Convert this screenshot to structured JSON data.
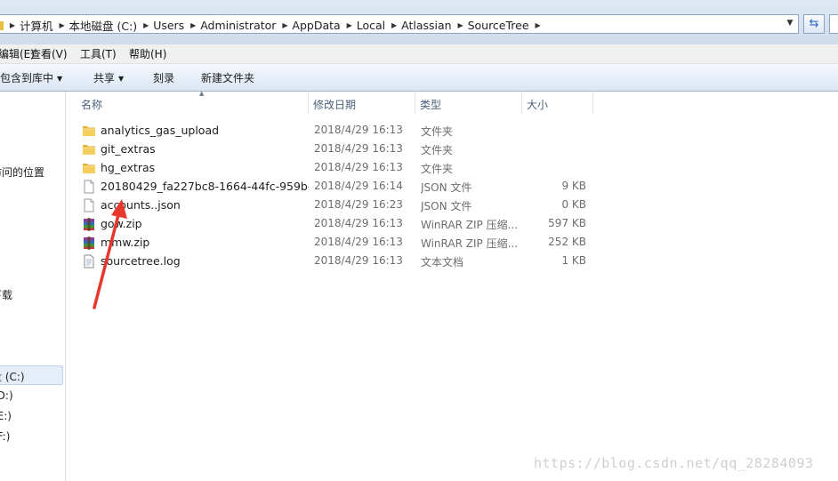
{
  "address_bar": {
    "crumbs": [
      "计算机",
      "本地磁盘 (C:)",
      "Users",
      "Administrator",
      "AppData",
      "Local",
      "Atlassian",
      "SourceTree"
    ]
  },
  "menu": {
    "items": [
      "编辑(E)",
      "查看(V)",
      "工具(T)",
      "帮助(H)"
    ]
  },
  "toolbar": {
    "include_library": "包含到库中",
    "share": "共享",
    "burn": "刻录",
    "new_folder": "新建文件夹"
  },
  "nav": {
    "recent_places": "最近访问的位置",
    "downloads": "下载",
    "drive_c": "本地磁盘 (C:)",
    "drive_d": "(D:)",
    "drive_e": "(E:)",
    "drive_f": "(F:)"
  },
  "columns": {
    "name": "名称",
    "date": "修改日期",
    "type": "类型",
    "size": "大小"
  },
  "files": [
    {
      "name": "analytics_gas_upload",
      "date": "2018/4/29 16:13",
      "type": "文件夹",
      "size": "",
      "icon": "folder-icon"
    },
    {
      "name": "git_extras",
      "date": "2018/4/29 16:13",
      "type": "文件夹",
      "size": "",
      "icon": "folder-icon"
    },
    {
      "name": "hg_extras",
      "date": "2018/4/29 16:13",
      "type": "文件夹",
      "size": "",
      "icon": "folder-icon"
    },
    {
      "name": "20180429_fa227bc8-1664-44fc-959b-...",
      "date": "2018/4/29 16:14",
      "type": "JSON 文件",
      "size": "9 KB",
      "icon": "file-icon"
    },
    {
      "name": "accounts..json",
      "date": "2018/4/29 16:23",
      "type": "JSON 文件",
      "size": "0 KB",
      "icon": "file-icon"
    },
    {
      "name": "gow.zip",
      "date": "2018/4/29 16:13",
      "type": "WinRAR ZIP 压缩...",
      "size": "597 KB",
      "icon": "winrar-archive-icon"
    },
    {
      "name": "mmw.zip",
      "date": "2018/4/29 16:13",
      "type": "WinRAR ZIP 压缩...",
      "size": "252 KB",
      "icon": "winrar-archive-icon"
    },
    {
      "name": "sourcetree.log",
      "date": "2018/4/29 16:13",
      "type": "文本文档",
      "size": "1 KB",
      "icon": "text-document-icon"
    }
  ],
  "watermark": "https://blog.csdn.net/qq_28284093",
  "colors": {
    "annotation_arrow": "#e8382e",
    "folder": "#f0c24a",
    "toolbar_bg": "#dbe6f4"
  }
}
